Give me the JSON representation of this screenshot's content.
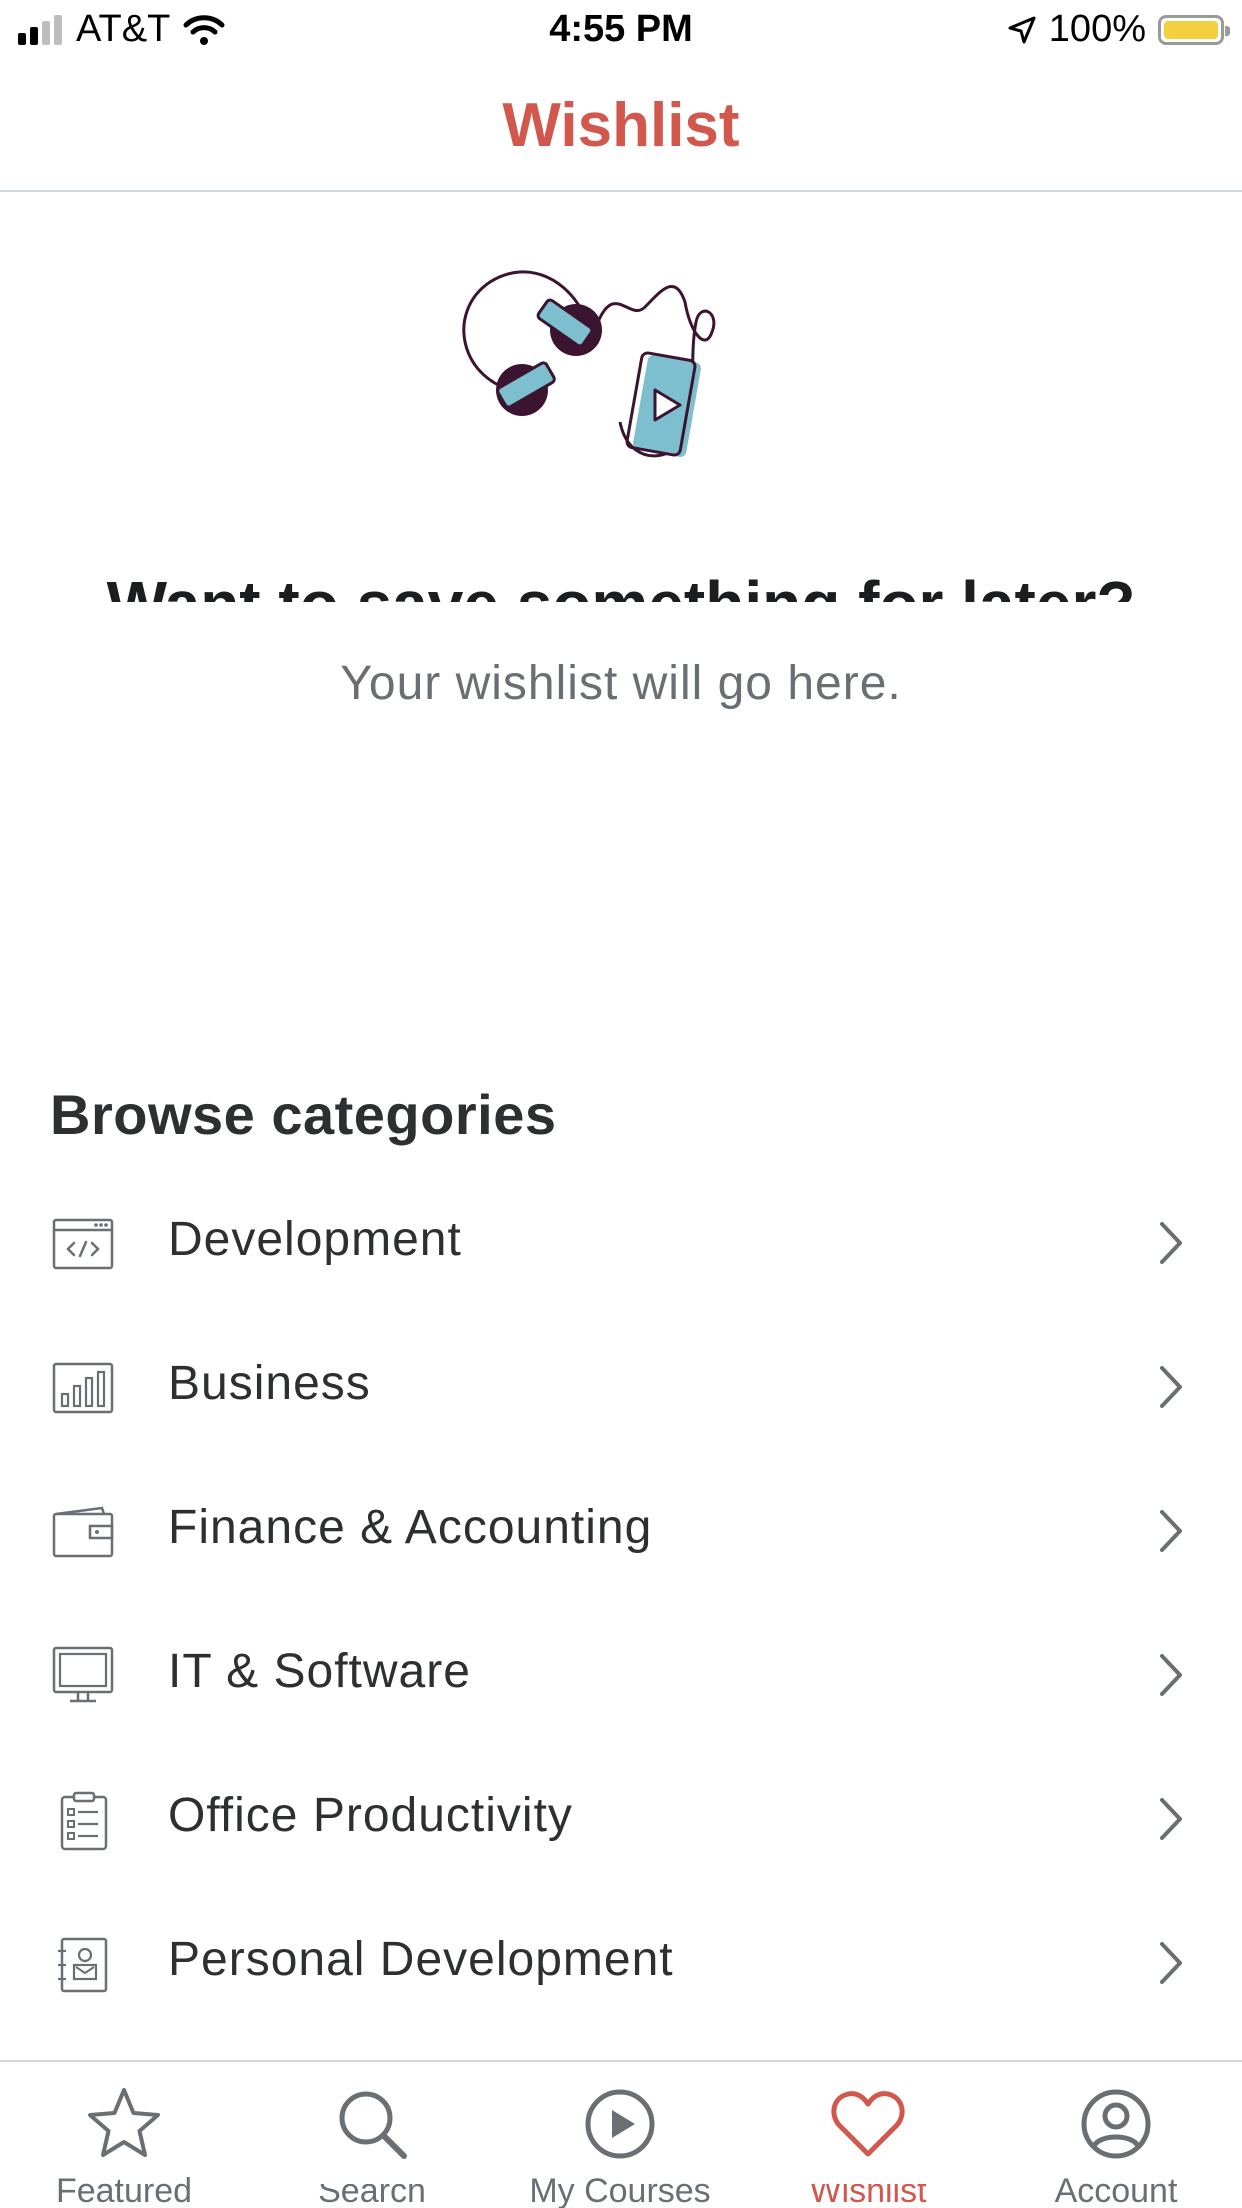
{
  "status_bar": {
    "carrier": "AT&T",
    "time": "4:55 PM",
    "battery": "100%"
  },
  "nav": {
    "title": "Wishlist"
  },
  "empty_state": {
    "headline": "Want to save something for later?",
    "subtitle": "Your wishlist will go here."
  },
  "browse": {
    "title": "Browse categories",
    "items": [
      {
        "label": "Development",
        "icon": "code-window-icon"
      },
      {
        "label": "Business",
        "icon": "bar-chart-icon"
      },
      {
        "label": "Finance & Accounting",
        "icon": "wallet-icon"
      },
      {
        "label": "IT & Software",
        "icon": "monitor-icon"
      },
      {
        "label": "Office Productivity",
        "icon": "clipboard-list-icon"
      },
      {
        "label": "Personal Development",
        "icon": "profile-book-icon"
      }
    ]
  },
  "tab_bar": {
    "tabs": [
      {
        "label": "Featured",
        "icon": "star-icon"
      },
      {
        "label": "Search",
        "icon": "search-icon"
      },
      {
        "label": "My Courses",
        "icon": "play-circle-icon"
      },
      {
        "label": "Wishlist",
        "icon": "heart-icon",
        "active": true
      },
      {
        "label": "Account",
        "icon": "account-icon"
      }
    ]
  },
  "colors": {
    "accent": "#d2584e",
    "text": "#2d2f31",
    "muted": "#6a6f73",
    "illustration_blue": "#7dbfcf",
    "illustration_dark": "#3b1530"
  }
}
